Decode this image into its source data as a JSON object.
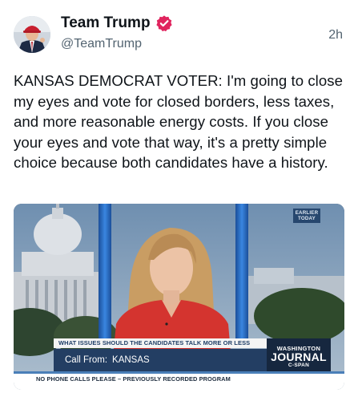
{
  "author": {
    "display_name": "Team Trump",
    "handle": "@TeamTrump",
    "verified_icon": "verified-badge-icon",
    "verified_color": "#e0245e"
  },
  "post": {
    "timestamp": "2h",
    "text": "KANSAS DEMOCRAT VOTER: I'm going to close my eyes and vote for closed borders, less taxes, and more reasonable energy costs. If you close your eyes and vote that way, it's a pretty simple choice because both candidates have a history."
  },
  "media": {
    "earlier_badge": "EARLIER TODAY",
    "question": "WHAT ISSUES SHOULD THE CANDIDATES TALK MORE OR LESS ABOUT?",
    "call_label": "Call From:",
    "call_value": "KANSAS",
    "program_line1": "WASHINGTON",
    "program_line2": "JOURNAL",
    "program_line3": "C-SPAN",
    "ticker": "NO PHONE CALLS PLEASE – PREVIOUSLY RECORDED PROGRAM"
  }
}
